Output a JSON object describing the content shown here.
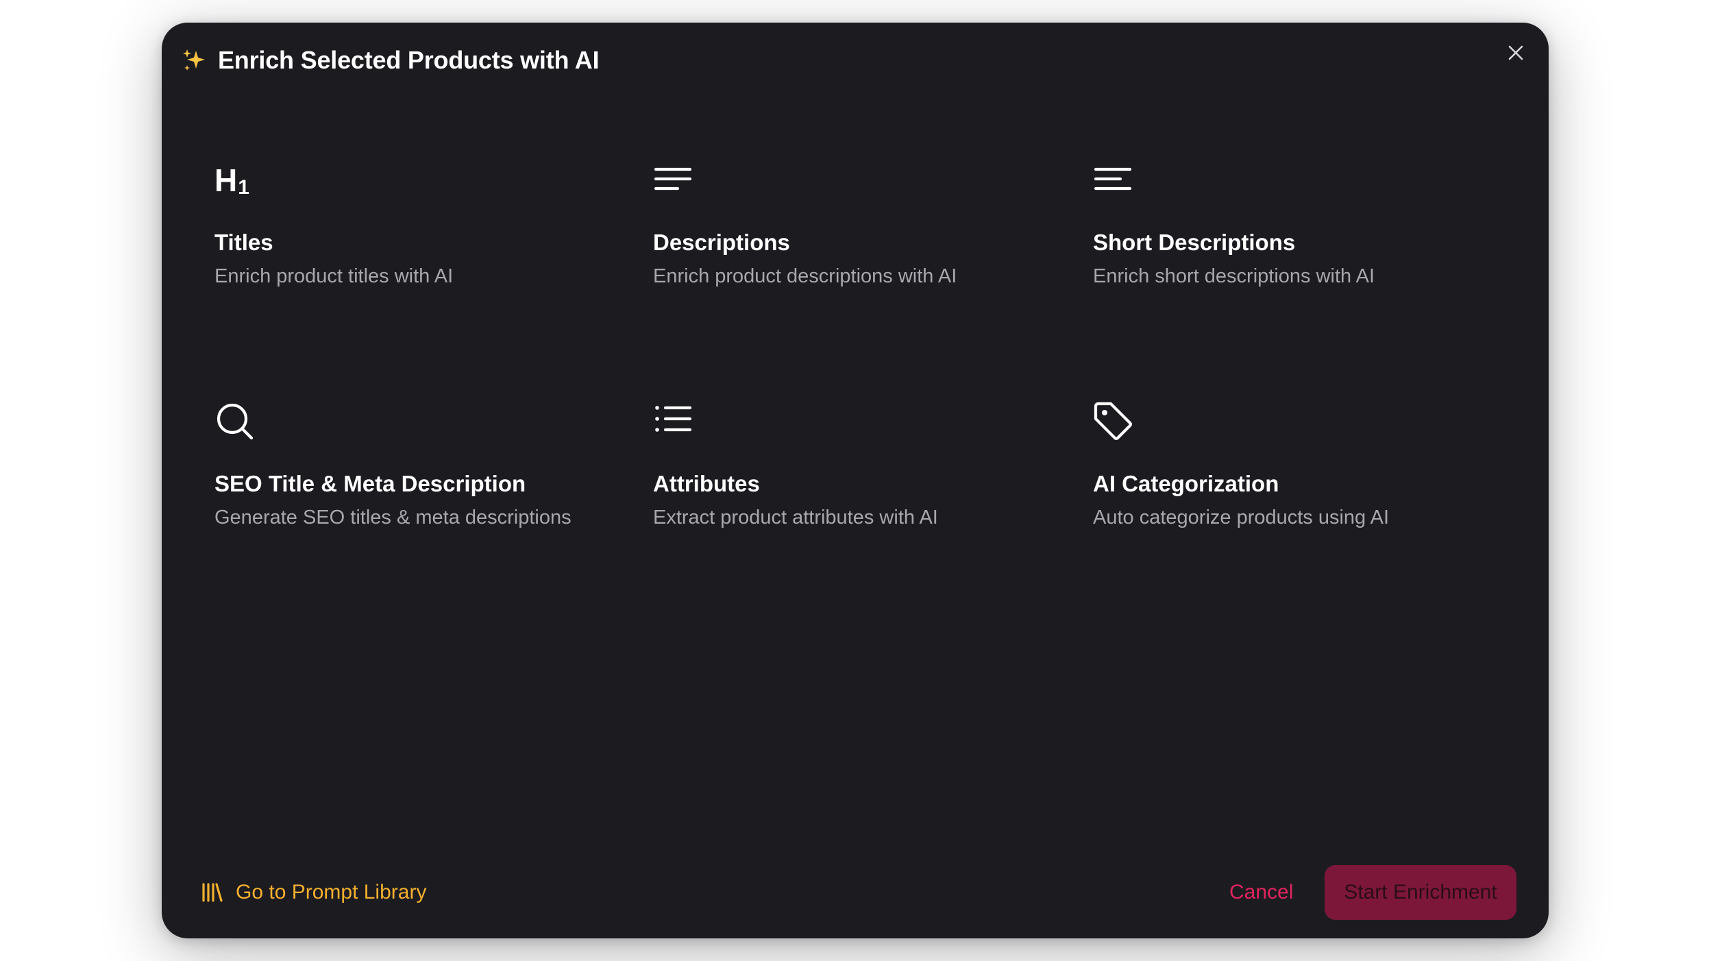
{
  "dialog": {
    "title": "Enrich Selected Products with AI",
    "colors": {
      "background": "#1c1b20",
      "title": "#ffffff",
      "description": "#a8a7ad",
      "link": "#f3b02f",
      "cancel": "#e0245e",
      "primary_button_bg": "#7d1739"
    }
  },
  "options": [
    {
      "icon": "heading-icon",
      "title": "Titles",
      "description": "Enrich product titles with AI"
    },
    {
      "icon": "align-left-icon",
      "title": "Descriptions",
      "description": "Enrich product descriptions with AI"
    },
    {
      "icon": "menu-lines-icon",
      "title": "Short Descriptions",
      "description": "Enrich short descriptions with AI"
    },
    {
      "icon": "search-icon",
      "title": "SEO Title & Meta Description",
      "description": "Generate SEO titles & meta descriptions"
    },
    {
      "icon": "list-icon",
      "title": "Attributes",
      "description": "Extract product attributes with AI"
    },
    {
      "icon": "tag-icon",
      "title": "AI Categorization",
      "description": "Auto categorize products using AI"
    }
  ],
  "footer": {
    "library_link": "Go to Prompt Library",
    "cancel_label": "Cancel",
    "start_label": "Start Enrichment"
  }
}
